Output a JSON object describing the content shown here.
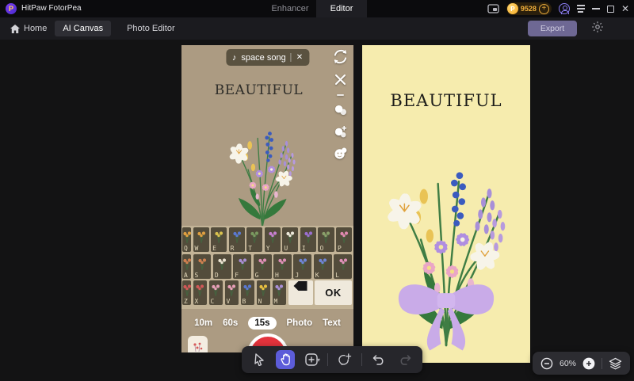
{
  "titlebar": {
    "app_title": "HitPaw FotorPea",
    "tabs": [
      {
        "label": "Enhancer",
        "active": false
      },
      {
        "label": "Editor",
        "active": true
      }
    ],
    "coin_count": "9528",
    "icons": [
      "mini-window-icon",
      "coin-icon",
      "coin-plus-icon",
      "account-icon",
      "menu-icon",
      "minimize-icon",
      "maximize-icon",
      "close-icon"
    ]
  },
  "navbar": {
    "home_label": "Home",
    "tabs": [
      {
        "label": "AI Canvas",
        "active": true
      },
      {
        "label": "Photo Editor",
        "active": false
      }
    ],
    "export_label": "Export",
    "icons": [
      "home-icon",
      "gear-icon"
    ]
  },
  "left_image": {
    "music_tag": {
      "icon": "music-note-icon",
      "glyph": "♪",
      "label": "space song",
      "close_glyph": "✕"
    },
    "caption": "BEAUTIFUL",
    "camera_icons": [
      "flip-camera-icon",
      "close-icon",
      "divider-dash",
      "filters-circles-icon",
      "effects-circles-plus-icon",
      "emoji-smiley-icon"
    ],
    "keyboard": {
      "rows": [
        [
          {
            "l": "Q",
            "c": "#e0a040",
            "partial": true
          },
          {
            "l": "W",
            "c": "#e0a040"
          },
          {
            "l": "E",
            "c": "#d9c24e"
          },
          {
            "l": "R",
            "c": "#5b79d0"
          },
          {
            "l": "T",
            "c": "#7a9a60"
          },
          {
            "l": "Y",
            "c": "#c77fd0"
          },
          {
            "l": "U",
            "c": "#ece8da"
          },
          {
            "l": "I",
            "c": "#9b6fd0"
          },
          {
            "l": "O",
            "c": "#8aa06a"
          },
          {
            "l": "P",
            "c": "#e089b0"
          }
        ],
        [
          {
            "l": "A",
            "c": "#d08050",
            "partial": true
          },
          {
            "l": "S",
            "c": "#d08050"
          },
          {
            "l": "D",
            "c": "#ece4d2"
          },
          {
            "l": "F",
            "c": "#a98fd6"
          },
          {
            "l": "G",
            "c": "#e090b8"
          },
          {
            "l": "H",
            "c": "#e090b8"
          },
          {
            "l": "J",
            "c": "#6f86d8"
          },
          {
            "l": "K",
            "c": "#6f86d8"
          },
          {
            "l": "L",
            "c": "#e090b8"
          }
        ],
        [
          {
            "l": "Z",
            "c": "#d05858",
            "partial": true
          },
          {
            "l": "X",
            "c": "#d05858"
          },
          {
            "l": "C",
            "c": "#e8a0b8"
          },
          {
            "l": "V",
            "c": "#e8a0b8"
          },
          {
            "l": "B",
            "c": "#5b79d0"
          },
          {
            "l": "N",
            "c": "#e8c040"
          },
          {
            "l": "M",
            "c": "#a98fd6"
          }
        ]
      ],
      "backspace_icon": "backspace-arrow-icon",
      "ok_label": "OK"
    },
    "modes": [
      "10m",
      "60s",
      "15s",
      "Photo",
      "Text"
    ],
    "selected_mode": "15s"
  },
  "right_image": {
    "caption": "BEAUTIFUL"
  },
  "toolbar": {
    "icons": [
      "select-arrow-icon",
      "hand-pan-icon",
      "add-element-icon",
      "chevron-down-icon",
      "annotate-plus-icon",
      "undo-icon",
      "redo-icon"
    ],
    "active_tool": "hand-pan-icon"
  },
  "zoom_control": {
    "level": "60%",
    "icons": [
      "zoom-out-icon",
      "zoom-in-icon",
      "layers-icon"
    ]
  },
  "colors": {
    "accent": "#5c5cd9",
    "export_button": "#6e6894",
    "coin": "#f2b13c",
    "left_bg": "#ac9b82",
    "right_bg": "#f6ecae",
    "record": "#e4333c",
    "bow": "#c9abe8"
  }
}
